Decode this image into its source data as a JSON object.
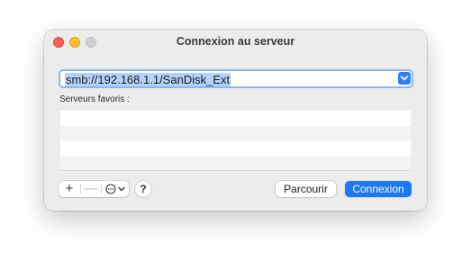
{
  "window": {
    "title": "Connexion au serveur"
  },
  "address": {
    "value": "smb://192.168.1.1/SanDisk_Ext",
    "dropdown_icon": "chevron-down-icon"
  },
  "favorites": {
    "label": "Serveurs favoris :",
    "items": []
  },
  "toolbar": {
    "add_label": "+",
    "remove_label": "—",
    "action_icon": "ellipsis-circle-icon",
    "help_label": "?"
  },
  "buttons": {
    "browse_label": "Parcourir",
    "connect_label": "Connexion"
  },
  "colors": {
    "accent": "#1e78f1",
    "close": "#ff5f57",
    "minimize": "#febc2e",
    "zoom_disabled": "#d1d0d0"
  }
}
